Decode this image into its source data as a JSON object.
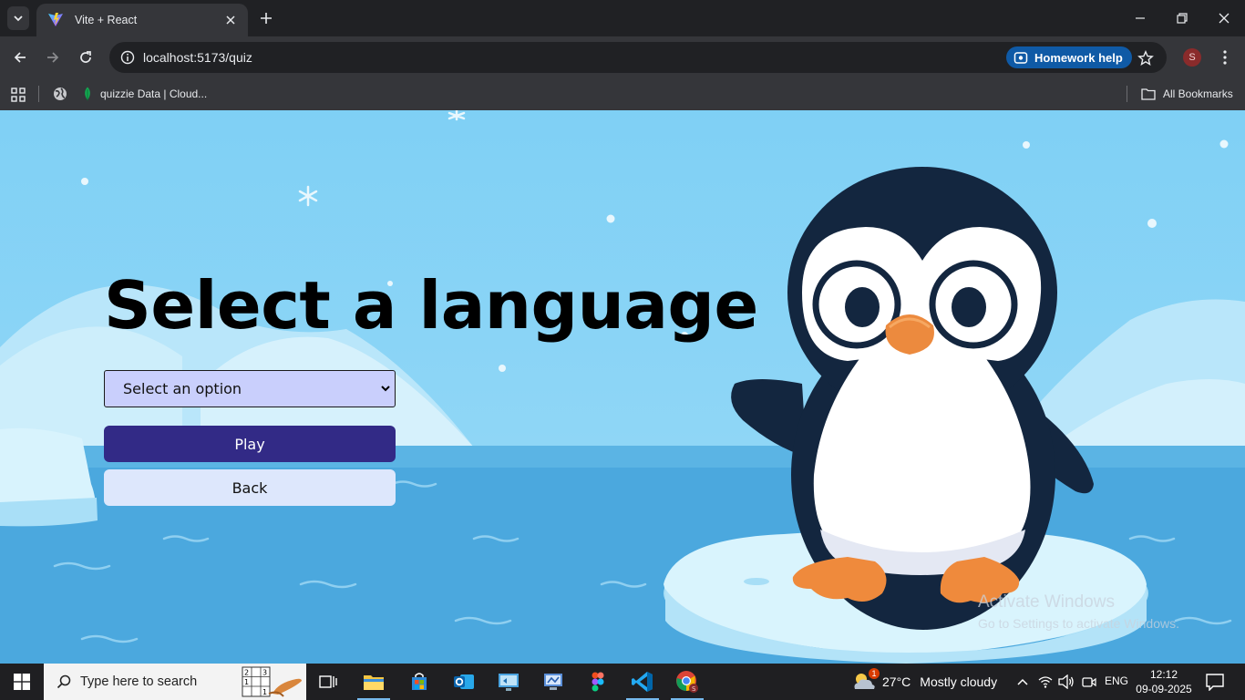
{
  "browser": {
    "tab_title": "Vite + React",
    "url": "localhost:5173/quiz",
    "homework_help_label": "Homework help",
    "profile_initial": "S"
  },
  "bookmarks": {
    "items": [
      {
        "label": "quizzie Data | Cloud..."
      }
    ],
    "all_bookmarks_label": "All Bookmarks"
  },
  "page": {
    "heading": "Select a language",
    "select": {
      "selected_label": "Select an option"
    },
    "play_label": "Play",
    "back_label": "Back"
  },
  "watermark": {
    "line1": "Activate Windows",
    "line2": "Go to Settings to activate Windows."
  },
  "taskbar": {
    "search_placeholder": "Type here to search",
    "weather_temp": "27°C",
    "weather_desc": "Mostly cloudy",
    "weather_badge": "1",
    "language": "ENG",
    "time": "12:12",
    "date": "09-09-2025",
    "apps": [
      "task-view",
      "file-explorer",
      "microsoft-store",
      "outlook",
      "remote-desktop",
      "control-panel",
      "figma",
      "vscode",
      "chrome"
    ]
  },
  "colors": {
    "sky": "#7fd0f5",
    "sea": "#4aa6dc",
    "play_button": "#322a86",
    "back_button": "#dde7fc",
    "select_bg": "#c9cffc",
    "penguin_dark": "#13263f",
    "beak": "#ec8a3e"
  }
}
